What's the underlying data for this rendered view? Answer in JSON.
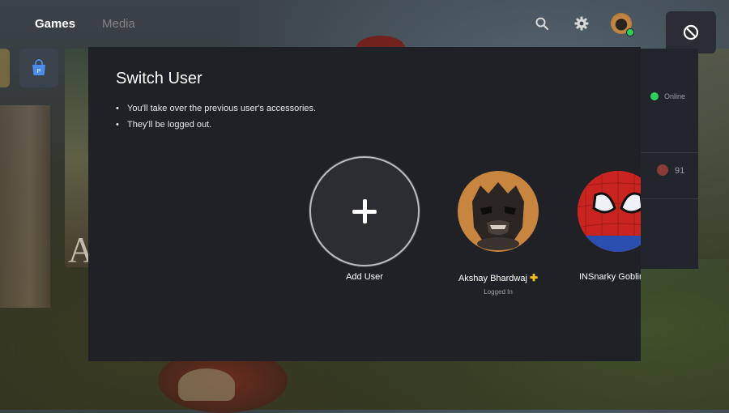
{
  "nav": {
    "tabs": [
      {
        "label": "Games",
        "active": true
      },
      {
        "label": "Media",
        "active": false
      }
    ],
    "icons": [
      "search-icon",
      "gear-icon",
      "avatar",
      "block-icon"
    ]
  },
  "side_panel": {
    "status": "Online",
    "trophy_count": "91"
  },
  "background": {
    "title_letter": "A"
  },
  "dialog": {
    "title": "Switch User",
    "bullets": [
      "You'll take over the previous user's accessories.",
      "They'll be logged out."
    ],
    "users": [
      {
        "label": "Add User",
        "icon": "plus-icon"
      },
      {
        "name": "Akshay Bhardwaj",
        "badge": "✚",
        "status": "Logged In"
      },
      {
        "name": "INSnarky Goblin"
      }
    ]
  },
  "colors": {
    "online": "#2bd15a",
    "ps_plus": "#f4c21a",
    "dialog_bg": "#1f2126"
  }
}
